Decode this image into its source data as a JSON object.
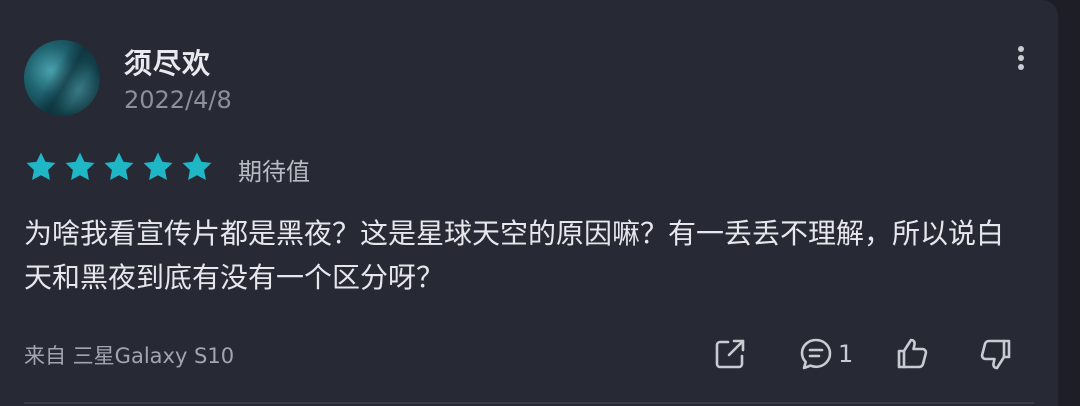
{
  "user": {
    "name": "须尽欢",
    "date": "2022/4/8"
  },
  "rating": {
    "stars": 5,
    "max_stars": 5,
    "label": "期待值",
    "star_color": "#1fb6c6"
  },
  "review": {
    "text": "为啥我看宣传片都是黑夜？这是星球天空的原因嘛？有一丢丢不理解，所以说白天和黑夜到底有没有一个区分呀？"
  },
  "footer": {
    "device": "来自 三星Galaxy S10",
    "comment_count": "1"
  },
  "icons": {
    "more": "more-vertical-icon",
    "share": "share-icon",
    "comment": "comment-icon",
    "like": "thumbs-up-icon",
    "dislike": "thumbs-down-icon"
  }
}
